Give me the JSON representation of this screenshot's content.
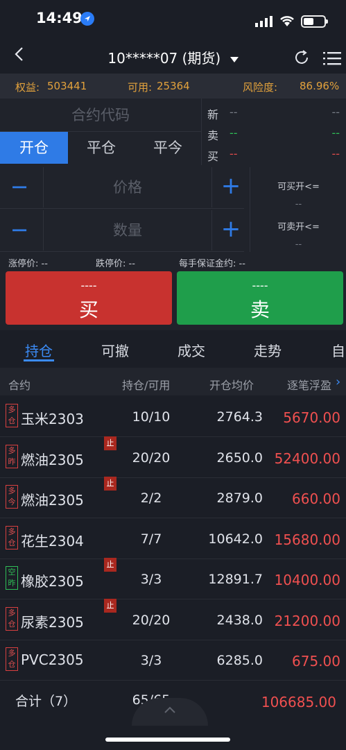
{
  "status": {
    "time": "14:49"
  },
  "nav": {
    "title": "10*****07 (期货)"
  },
  "info": {
    "equity_label": "权益:",
    "equity_value": "503441",
    "avail_label": "可用:",
    "avail_value": "25364",
    "risk_label": "风险度:",
    "risk_value": "86.96%"
  },
  "order": {
    "code_placeholder": "合约代码",
    "tabs": [
      "开仓",
      "平仓",
      "平今"
    ],
    "price_placeholder": "价格",
    "qty_placeholder": "数量",
    "minus": "−",
    "plus": "+",
    "quote": {
      "new_label": "新",
      "sell_label": "卖",
      "buy_label": "买",
      "dash": "--"
    },
    "can_buy_label": "可买开<=",
    "can_buy_value": "--",
    "can_sell_label": "可卖开<=",
    "can_sell_value": "--",
    "limit_up": "涨停价: --",
    "limit_down": "跌停价: --",
    "margin": "每手保证金约: --",
    "buy_btn": {
      "dash": "----",
      "label": "买"
    },
    "sell_btn": {
      "dash": "----",
      "label": "卖"
    }
  },
  "subtabs": [
    "持仓",
    "可撤",
    "成交",
    "走势",
    "自"
  ],
  "table": {
    "headers": [
      "合约",
      "持仓/可用",
      "开仓均价",
      "逐笔浮盈"
    ],
    "rows": [
      {
        "badge": "多仓",
        "name": "玉米2303",
        "stop": "",
        "pos": "10/10",
        "avg": "2764.3",
        "pnl": "5670.00",
        "green": false
      },
      {
        "badge": "多昨",
        "name": "燃油2305",
        "stop": "止",
        "pos": "20/20",
        "avg": "2650.0",
        "pnl": "52400.00",
        "green": false
      },
      {
        "badge": "多今",
        "name": "燃油2305",
        "stop": "止",
        "pos": "2/2",
        "avg": "2879.0",
        "pnl": "660.00",
        "green": false
      },
      {
        "badge": "多仓",
        "name": "花生2304",
        "stop": "",
        "pos": "7/7",
        "avg": "10642.0",
        "pnl": "15680.00",
        "green": false
      },
      {
        "badge": "空昨",
        "name": "橡胶2305",
        "stop": "止",
        "pos": "3/3",
        "avg": "12891.7",
        "pnl": "10400.00",
        "green": true
      },
      {
        "badge": "多仓",
        "name": "尿素2305",
        "stop": "止",
        "pos": "20/20",
        "avg": "2438.0",
        "pnl": "21200.00",
        "green": false
      },
      {
        "badge": "多仓",
        "name": "PVC2305",
        "stop": "",
        "pos": "3/3",
        "avg": "6285.0",
        "pnl": "675.00",
        "green": false
      }
    ],
    "total": {
      "label": "合计（7）",
      "pos": "65/65",
      "pnl": "106685.00"
    }
  }
}
